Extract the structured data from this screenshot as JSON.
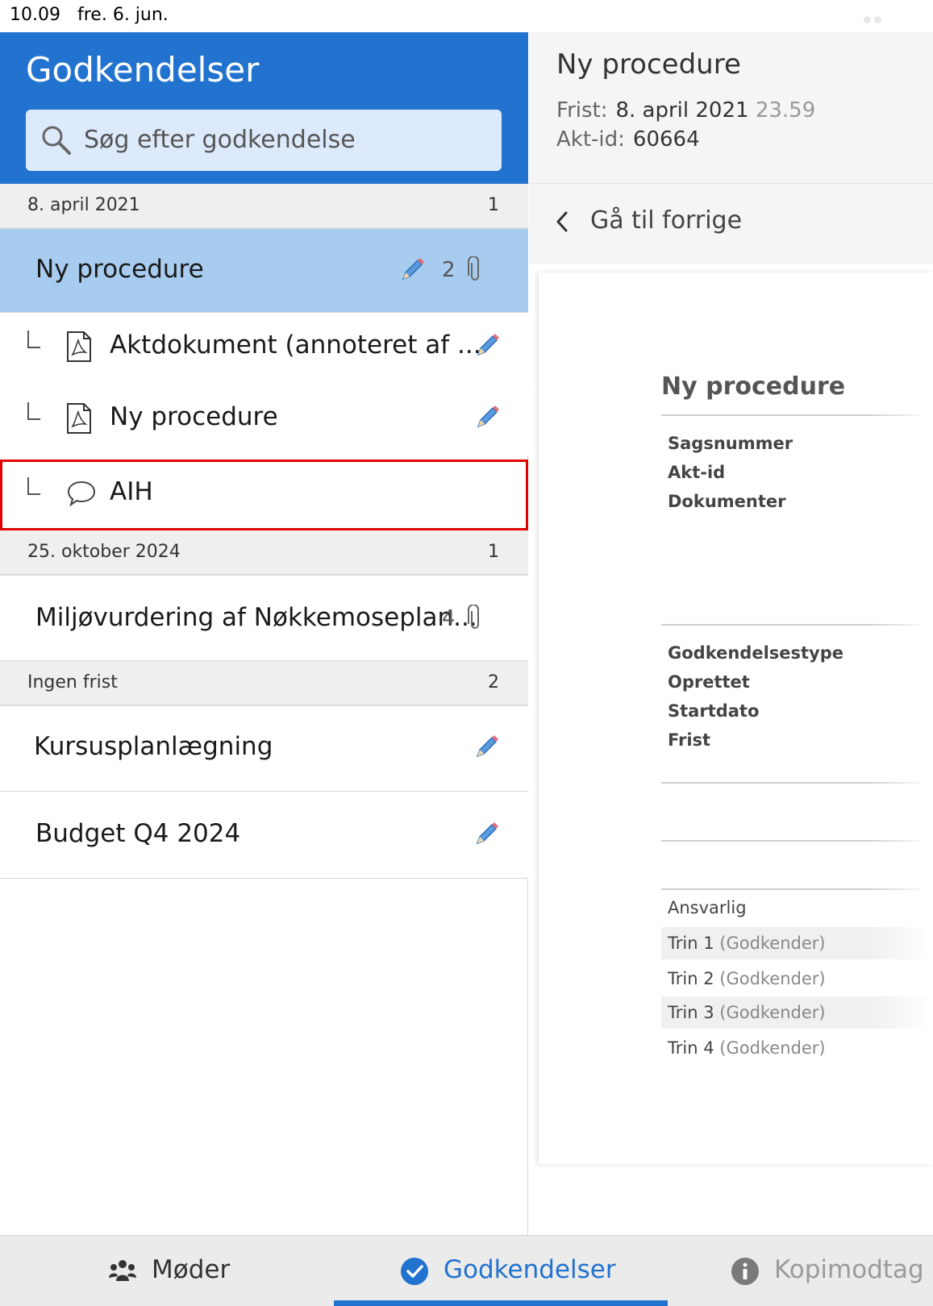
{
  "status_bar": {
    "time": "10.09",
    "date": "fre. 6. jun."
  },
  "left_panel": {
    "title": "Godkendelser",
    "search_placeholder": "Søg efter godkendelse",
    "groups": [
      {
        "label": "8. april 2021",
        "count": "1"
      },
      {
        "label": "25. oktober 2024",
        "count": "1"
      },
      {
        "label": "Ingen frist",
        "count": "2"
      }
    ],
    "items": {
      "ny_procedure": {
        "title": "Ny procedure",
        "attachment_count": "2"
      },
      "sub_aktdokument": "Aktdokument (annoteret af ...",
      "sub_ny_procedure": "Ny procedure",
      "sub_aih": "AIH",
      "miljo": {
        "title": "Miljøvurdering af Nøkkemoseplan...",
        "attachment_count": "4"
      },
      "kursus": "Kursusplanlægning",
      "budget": "Budget Q4 2024"
    }
  },
  "right_panel": {
    "title": "Ny procedure",
    "deadline_label": "Frist:",
    "deadline_date": "8. april 2021",
    "deadline_time": "23.59",
    "act_id_label": "Akt-id:",
    "act_id": "60664",
    "back_label": "Gå til forrige",
    "document": {
      "title": "Ny procedure",
      "labels_1": [
        "Sagsnummer",
        "Akt-id",
        "Dokumenter"
      ],
      "labels_2": [
        "Godkendelsestype",
        "Oprettet",
        "Startdato",
        "Frist"
      ],
      "responsible": "Ansvarlig",
      "steps": [
        {
          "step": "Trin 1",
          "role": "(Godkender)"
        },
        {
          "step": "Trin 2",
          "role": "(Godkender)"
        },
        {
          "step": "Trin 3",
          "role": "(Godkender)"
        },
        {
          "step": "Trin 4",
          "role": "(Godkender)"
        }
      ]
    }
  },
  "tab_bar": {
    "tabs": [
      {
        "label": "Møder",
        "icon": "people-icon"
      },
      {
        "label": "Godkendelser",
        "icon": "checkmark-circle-icon"
      },
      {
        "label": "Kopimodtag",
        "icon": "info-icon"
      }
    ]
  },
  "colors": {
    "accent": "#2272cf",
    "selected_row": "#a8ccf0",
    "search_bg": "#dceafc",
    "highlight_outline": "#e00000"
  }
}
